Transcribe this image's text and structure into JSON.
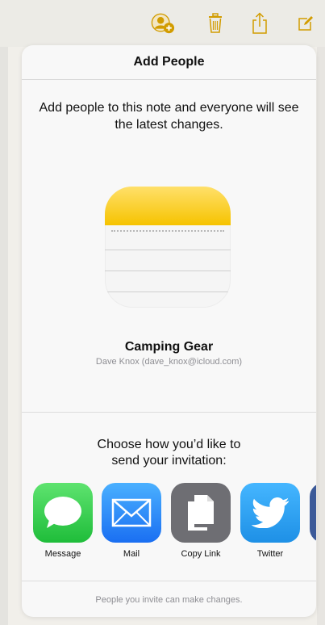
{
  "toolbar": {
    "icons": [
      "add-people-icon",
      "trash-icon",
      "share-icon",
      "compose-icon"
    ],
    "accent": "#d29c00"
  },
  "sheet": {
    "title": "Add People",
    "description": "Add people to this note and everyone will see the latest changes.",
    "note": {
      "name": "Camping Gear",
      "owner": "Dave Knox (dave_knox@icloud.com)"
    },
    "choose_text": "Choose how you’d like to send your invitation:",
    "apps": [
      {
        "label": "Message",
        "icon": "message-icon",
        "color": "#31c84a"
      },
      {
        "label": "Mail",
        "icon": "mail-icon",
        "color": "#2d86f5"
      },
      {
        "label": "Copy Link",
        "icon": "copy-link-icon",
        "color": "#6d6d72"
      },
      {
        "label": "Twitter",
        "icon": "twitter-icon",
        "color": "#2aa1ef"
      }
    ],
    "footer": "People you invite can make changes."
  }
}
